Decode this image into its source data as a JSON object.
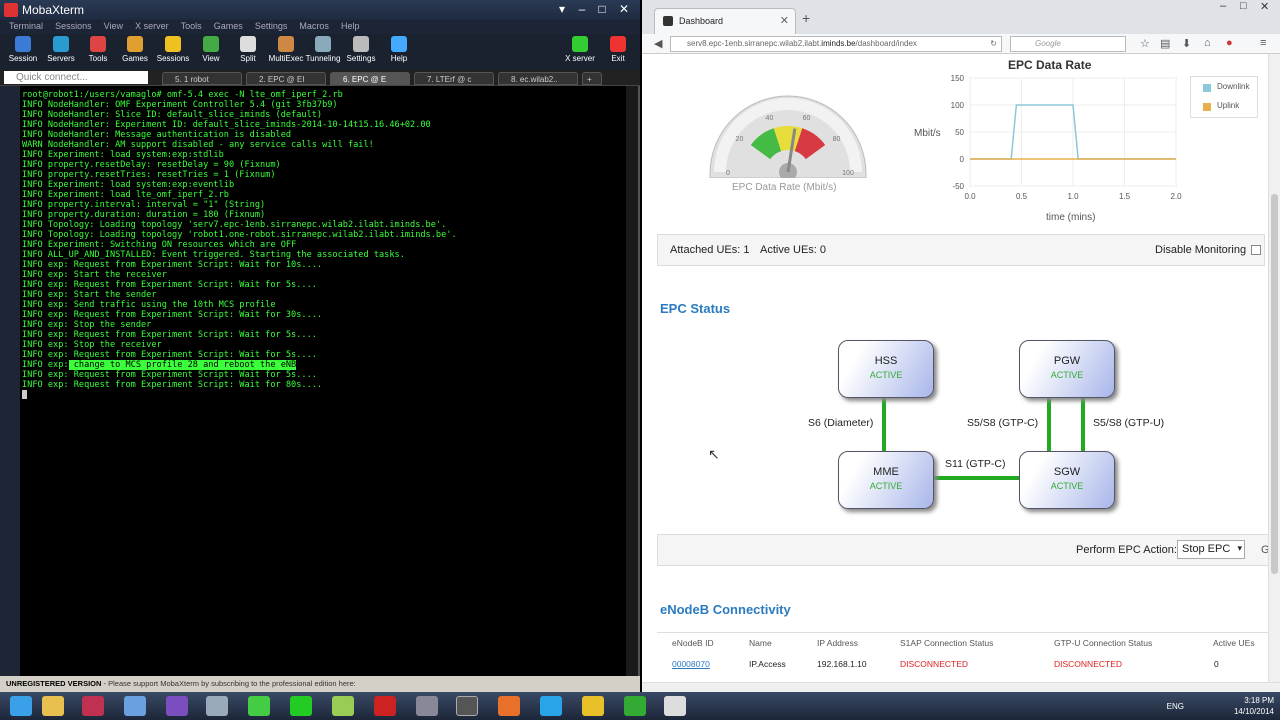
{
  "moba": {
    "title": "MobaXterm",
    "menu": [
      "Terminal",
      "Sessions",
      "View",
      "X server",
      "Tools",
      "Games",
      "Settings",
      "Macros",
      "Help"
    ],
    "toolbar": [
      {
        "label": "Session",
        "color": "#3a7bd5"
      },
      {
        "label": "Servers",
        "color": "#2a9bd0"
      },
      {
        "label": "Tools",
        "color": "#d44"
      },
      {
        "label": "Games",
        "color": "#e0a030"
      },
      {
        "label": "Sessions",
        "color": "#f0c020"
      },
      {
        "label": "View",
        "color": "#4a4"
      },
      {
        "label": "Split",
        "color": "#ddd"
      },
      {
        "label": "MultiExec",
        "color": "#c84"
      },
      {
        "label": "Tunneling",
        "color": "#8ab"
      },
      {
        "label": "Settings",
        "color": "#bbb"
      },
      {
        "label": "Help",
        "color": "#4af"
      },
      {
        "label": "X server",
        "color": "#3c3"
      },
      {
        "label": "Exit",
        "color": "#e33"
      }
    ],
    "quick_connect": "Quick connect...",
    "tabs": [
      "5. 1 robot",
      "2. EPC @ EI",
      "6. EPC @ E",
      "7. LTErf @ c",
      "8. ec.wilab2.."
    ],
    "status_prefix": "UNREGISTERED VERSION",
    "status_text": "  -  Please support MobaXterm by subscribing to the professional edition here:"
  },
  "terminal": {
    "prompt": "root@robot1:/users/vamaglo# omf-5.4 exec -N lte_omf_iperf_2.rb",
    "lines": [
      "INFO NodeHandler: OMF Experiment Controller 5.4 (git 3fb37b9)",
      "INFO NodeHandler: Slice ID: default_slice_iminds (default)",
      "INFO NodeHandler: Experiment ID: default_slice_iminds-2014-10-14t15.16.46+02.00",
      "INFO NodeHandler: Message authentication is disabled",
      "WARN NodeHandler: AM support disabled - any service calls will fail!",
      "INFO Experiment: load system:exp:stdlib",
      "INFO property.resetDelay: resetDelay = 90 (Fixnum)",
      "INFO property.resetTries: resetTries = 1 (Fixnum)",
      "INFO Experiment: load system:exp:eventlib",
      "INFO Experiment: load lte_omf_iperf_2.rb",
      "INFO property.interval: interval = \"1\" (String)",
      "INFO property.duration: duration = 180 (Fixnum)",
      "INFO Topology: Loading topology 'serv7.epc-1enb.sirranepc.wilab2.ilabt.iminds.be'.",
      "INFO Topology: Loading topology 'robot1.one-robot.sirranepc.wilab2.ilabt.iminds.be'.",
      "INFO Experiment: Switching ON resources which are OFF",
      "INFO ALL_UP_AND_INSTALLED: Event triggered. Starting the associated tasks.",
      "INFO exp: Request from Experiment Script: Wait for 10s....",
      "INFO exp: Start the receiver",
      "INFO exp: Request from Experiment Script: Wait for 5s....",
      "INFO exp: Start the sender",
      "INFO exp: Send traffic using the 10th MCS profile",
      "INFO exp: Request from Experiment Script: Wait for 30s....",
      "INFO exp: Stop the sender",
      "INFO exp: Request from Experiment Script: Wait for 5s....",
      "INFO exp: Stop the receiver",
      "INFO exp: Request from Experiment Script: Wait for 5s...."
    ],
    "hl_prefix": "INFO exp:",
    "hl_text": " change to MCS profile 28 and reboot the eNB",
    "tail": [
      "INFO exp: Request from Experiment Script: Wait for 5s....",
      "INFO exp: Request from Experiment Script: Wait for 80s...."
    ]
  },
  "browser": {
    "tab_title": "Dashboard",
    "url_prefix": "serv8.epc-1enb.sirranepc.wilab2.ilabt.",
    "url_domain": "iminds.be",
    "url_path": "/dashboard/index",
    "search_placeholder": "Google"
  },
  "dashboard": {
    "gauge": {
      "label": "EPC Data Rate (Mbit/s)",
      "ticks": [
        "0",
        "20",
        "40",
        "60",
        "80",
        "100"
      ],
      "value": 55
    },
    "chart_data": {
      "type": "line",
      "title": "EPC Data Rate",
      "xlabel": "time (mins)",
      "ylabel": "Mbit/s",
      "xlim": [
        0,
        2.0
      ],
      "ylim": [
        -50,
        150
      ],
      "xticks": [
        "0.0",
        "0.5",
        "1.0",
        "1.5",
        "2.0"
      ],
      "yticks": [
        "150",
        "100",
        "50",
        "0",
        "-50"
      ],
      "legend_position": "right",
      "series": [
        {
          "name": "Downlink",
          "color": "#8cc8d8",
          "x": [
            0,
            0.4,
            0.45,
            1.0,
            1.05,
            2.0
          ],
          "y": [
            0,
            0,
            100,
            100,
            0,
            0
          ]
        },
        {
          "name": "Uplink",
          "color": "#e8b04a",
          "x": [
            0,
            2.0
          ],
          "y": [
            0,
            0
          ]
        }
      ]
    },
    "ues": {
      "attached": "Attached UEs: 1",
      "active": "Active UEs: 0",
      "disable_label": "Disable Monitoring"
    },
    "epc_status_title": "EPC Status",
    "nodes": {
      "hss": {
        "name": "HSS",
        "status": "ACTIVE"
      },
      "pgw": {
        "name": "PGW",
        "status": "ACTIVE"
      },
      "mme": {
        "name": "MME",
        "status": "ACTIVE"
      },
      "sgw": {
        "name": "SGW",
        "status": "ACTIVE"
      }
    },
    "edges": {
      "s6": "S6 (Diameter)",
      "s5c": "S5/S8 (GTP-C)",
      "s5u": "S5/S8 (GTP-U)",
      "s11": "S11 (GTP-C)"
    },
    "action": {
      "label": "Perform EPC Action:",
      "selected": "Stop EPC",
      "go": "G"
    },
    "enb_title": "eNodeB Connectivity",
    "enb_headers": [
      "eNodeB ID",
      "Name",
      "IP Address",
      "S1AP Connection Status",
      "GTP-U Connection Status",
      "Active UEs"
    ],
    "enb_row": [
      "00008070",
      "IP.Access",
      "192.168.1.10",
      "DISCONNECTED",
      "DISCONNECTED",
      "0"
    ]
  },
  "taskbar": {
    "lang": "ENG",
    "time": "3:18 PM",
    "date": "14/10/2014"
  }
}
